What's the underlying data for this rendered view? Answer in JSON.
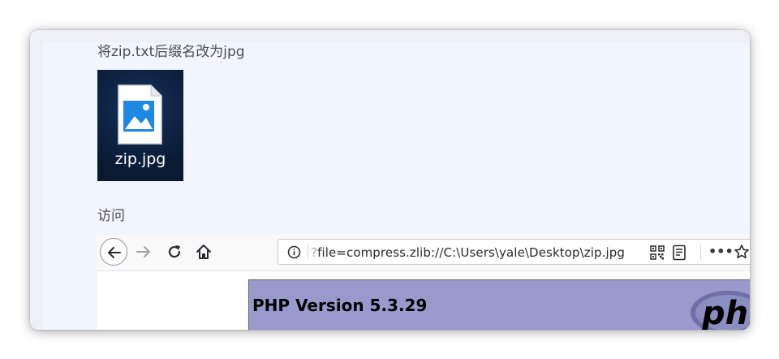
{
  "doc": {
    "step1_caption": "将zip.txt后缀名改为jpg",
    "file_name": "zip.jpg",
    "step2_caption": "访问"
  },
  "browser": {
    "url_query_mark": "?",
    "url_text": "file=compress.zlib://C:\\Users\\yale\\Desktop\\zip.jpg",
    "more_label": "•••"
  },
  "page": {
    "php_title": "PHP Version 5.3.29",
    "logo_text": "php"
  },
  "colors": {
    "php_banner": "#9999cc",
    "file_tile_bg": "#0b1e3a",
    "image_icon_blue": "#1e88e5"
  }
}
